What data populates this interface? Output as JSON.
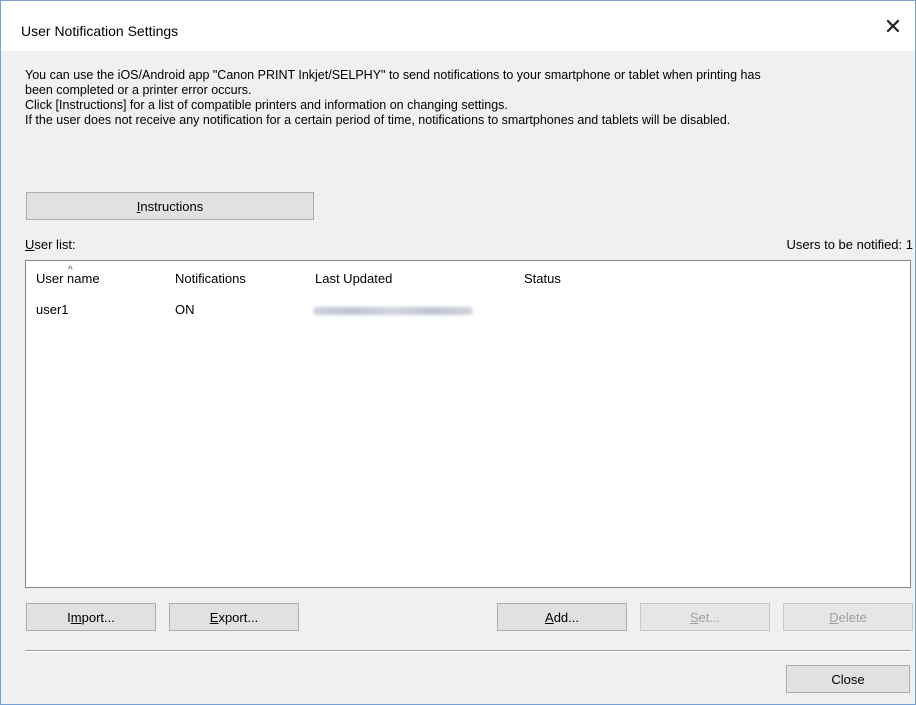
{
  "window": {
    "title": "User Notification Settings",
    "close_glyph": "✕"
  },
  "description": [
    "You can use the iOS/Android app \"Canon PRINT Inkjet/SELPHY\" to send notifications to your smartphone or tablet when printing has",
    "been completed or a printer error occurs.",
    "Click [Instructions] for a list of compatible printers and information on changing settings.",
    "If the user does not receive any notification for a certain period of time, notifications to smartphones and tablets will be disabled."
  ],
  "instructions_button": {
    "accel": "I",
    "rest": "nstructions"
  },
  "user_list": {
    "label_accel": "U",
    "label_rest": "ser list:",
    "count_text": "Users to be notified: 1",
    "columns": [
      "User name",
      "Notifications",
      "Last Updated",
      "Status"
    ],
    "sort_indicator": "^",
    "rows": [
      {
        "user_name": "user1",
        "notifications": "ON",
        "status": ""
      }
    ]
  },
  "buttons": {
    "import": {
      "pre": "I",
      "accel": "m",
      "post": "port..."
    },
    "export": {
      "pre": "",
      "accel": "E",
      "post": "xport..."
    },
    "add": {
      "pre": "",
      "accel": "A",
      "post": "dd..."
    },
    "set": {
      "pre": "",
      "accel": "S",
      "post": "et..."
    },
    "delete": {
      "pre": "",
      "accel": "D",
      "post": "elete"
    },
    "close": "Close"
  },
  "colors": {
    "dialog_bg": "#f0f0f0",
    "window_border": "#7a9fd3",
    "disabled_text": "#a0a0a0"
  }
}
